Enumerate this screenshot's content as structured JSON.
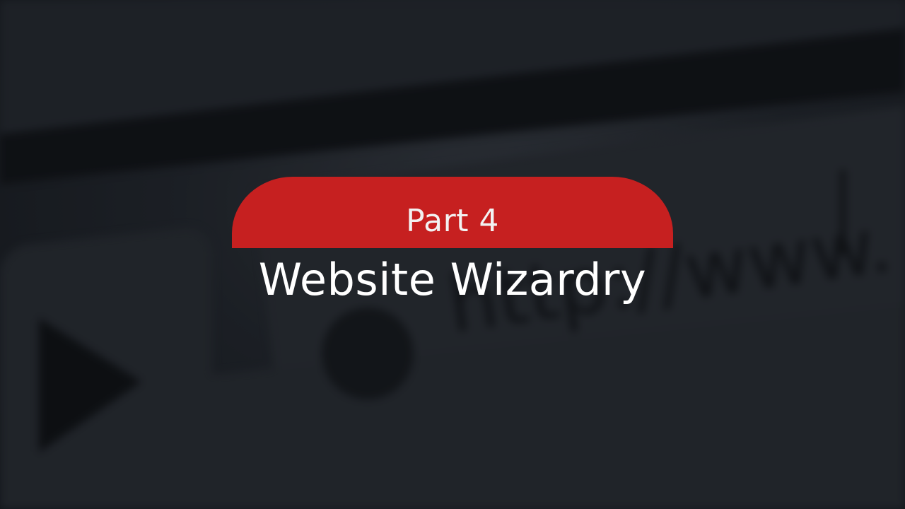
{
  "banner": {
    "label": "Part 4"
  },
  "title": "Website Wizardry",
  "background": {
    "address_text": "http://www.",
    "icons": [
      "play-icon",
      "globe-icon"
    ]
  },
  "colors": {
    "banner_red": "#c62020",
    "title_white": "#ffffff",
    "background_dark": "#1b1e24"
  }
}
